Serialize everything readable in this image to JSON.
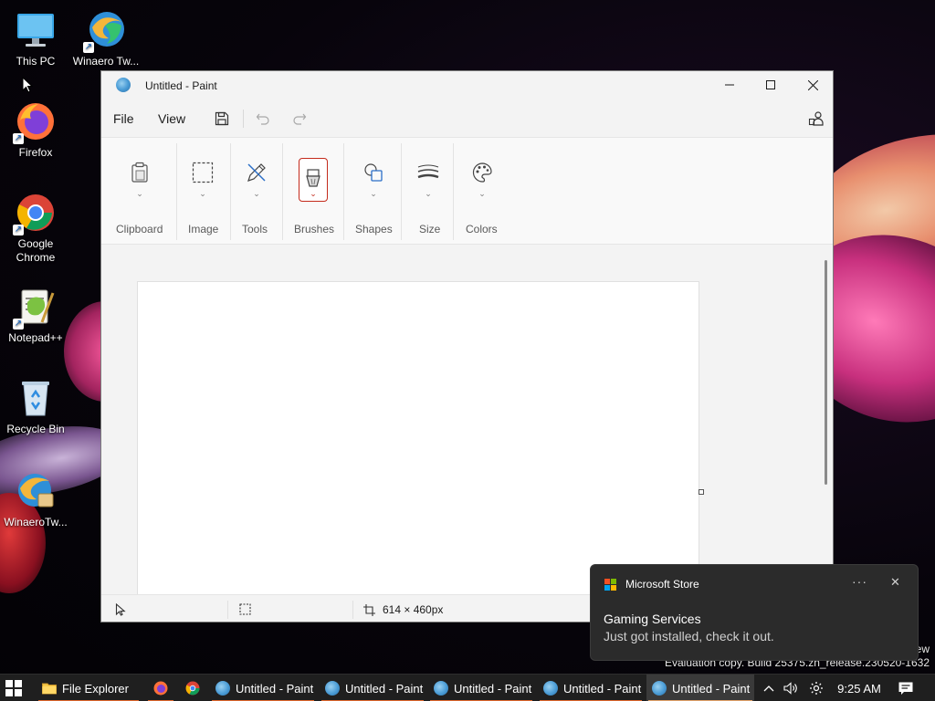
{
  "desktop": {
    "icons": [
      {
        "label": "This PC",
        "icon": "computer-icon"
      },
      {
        "label": "Winaero Tw...",
        "icon": "winaero-icon"
      },
      {
        "label": "Firefox",
        "icon": "firefox-icon"
      },
      {
        "label": "Google Chrome",
        "icon": "chrome-icon"
      },
      {
        "label": "Notepad++",
        "icon": "notepadpp-icon"
      },
      {
        "label": "Recycle Bin",
        "icon": "recycle-bin-icon"
      },
      {
        "label": "WinaeroTw...",
        "icon": "winaero-tweaker-icon"
      }
    ],
    "watermark": {
      "line1": "ew",
      "line2": "Evaluation copy. Build 25375.zn_release.230520-1632"
    }
  },
  "paint": {
    "title": "Untitled - Paint",
    "menu": {
      "file": "File",
      "view": "View"
    },
    "ribbon": {
      "groups": [
        "Clipboard",
        "Image",
        "Tools",
        "Brushes",
        "Shapes",
        "Size",
        "Colors"
      ],
      "selected_group": "Brushes"
    },
    "status": {
      "canvas_size": "614 × 460px"
    }
  },
  "toast": {
    "source": "Microsoft Store",
    "heading": "Gaming Services",
    "body": "Just got installed, check it out.",
    "more": "···",
    "close": "✕"
  },
  "taskbar": {
    "items": [
      {
        "label": "File Explorer",
        "icon": "folder-icon"
      },
      {
        "label": "",
        "icon": "firefox-icon"
      },
      {
        "label": "",
        "icon": "chrome-icon"
      },
      {
        "label": "Untitled - Paint",
        "icon": "paint-icon"
      },
      {
        "label": "Untitled - Paint",
        "icon": "paint-icon"
      },
      {
        "label": "Untitled - Paint",
        "icon": "paint-icon"
      },
      {
        "label": "Untitled - Paint",
        "icon": "paint-icon"
      },
      {
        "label": "Untitled - Paint",
        "icon": "paint-icon",
        "active": true
      }
    ],
    "tray": {
      "time": "9:25 AM"
    }
  },
  "colors": {
    "accent_red": "#c42b1c",
    "taskbar_underline": "#e0682e",
    "toast_bg": "#2b2b2b",
    "taskbar_bg": "#1f1f1f"
  }
}
